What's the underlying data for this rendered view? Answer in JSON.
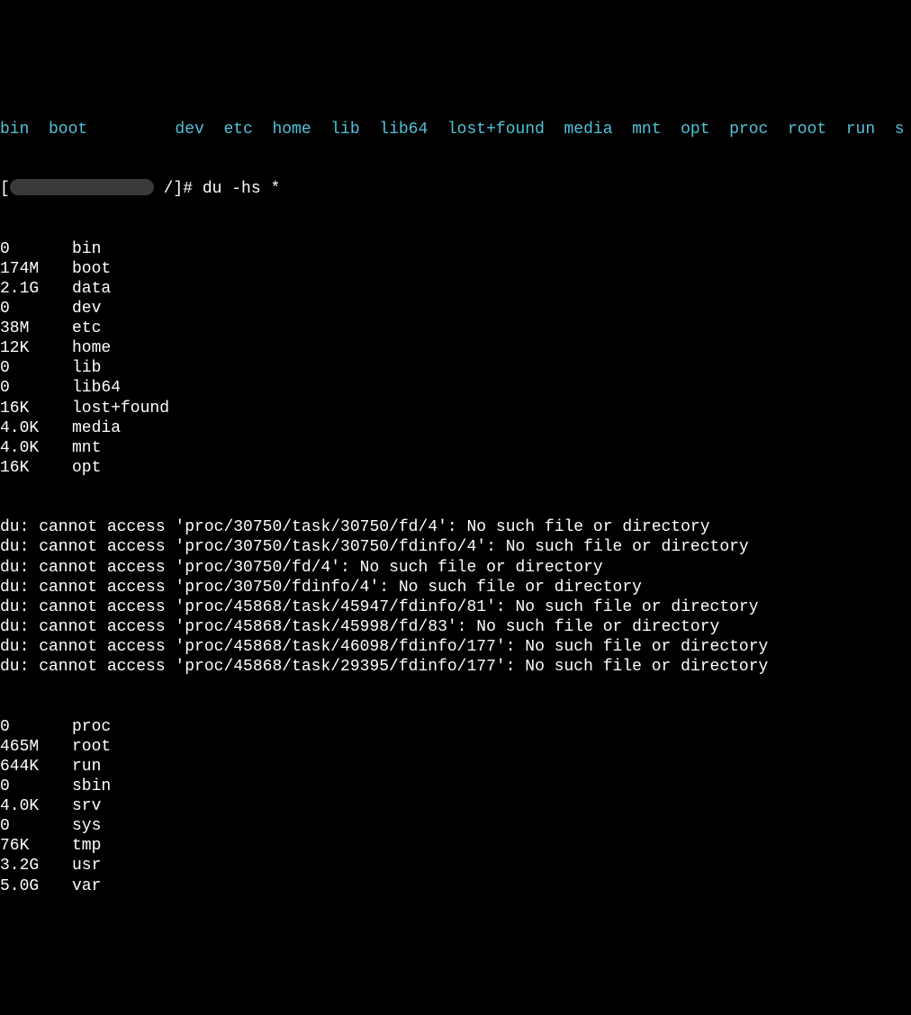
{
  "top_dirs": "bin  boot         dev  etc  home  lib  lib64  lost+found  media  mnt  opt  proc  root  run  s",
  "prompt": {
    "open_bracket": "[",
    "path_suffix": " /]# ",
    "command": "du -hs *"
  },
  "entries_before": [
    {
      "size": "0",
      "name": "bin"
    },
    {
      "size": "174M",
      "name": "boot"
    },
    {
      "size": "2.1G",
      "name": "data"
    },
    {
      "size": "0",
      "name": "dev"
    },
    {
      "size": "38M",
      "name": "etc"
    },
    {
      "size": "12K",
      "name": "home"
    },
    {
      "size": "0",
      "name": "lib"
    },
    {
      "size": "0",
      "name": "lib64"
    },
    {
      "size": "16K",
      "name": "lost+found"
    },
    {
      "size": "4.0K",
      "name": "media"
    },
    {
      "size": "4.0K",
      "name": "mnt"
    },
    {
      "size": "16K",
      "name": "opt"
    }
  ],
  "errors": [
    "du: cannot access 'proc/30750/task/30750/fd/4': No such file or directory",
    "du: cannot access 'proc/30750/task/30750/fdinfo/4': No such file or directory",
    "du: cannot access 'proc/30750/fd/4': No such file or directory",
    "du: cannot access 'proc/30750/fdinfo/4': No such file or directory",
    "du: cannot access 'proc/45868/task/45947/fdinfo/81': No such file or directory",
    "du: cannot access 'proc/45868/task/45998/fd/83': No such file or directory",
    "du: cannot access 'proc/45868/task/46098/fdinfo/177': No such file or directory",
    "du: cannot access 'proc/45868/task/29395/fdinfo/177': No such file or directory"
  ],
  "entries_after": [
    {
      "size": "0",
      "name": "proc"
    },
    {
      "size": "465M",
      "name": "root"
    },
    {
      "size": "644K",
      "name": "run"
    },
    {
      "size": "0",
      "name": "sbin"
    },
    {
      "size": "4.0K",
      "name": "srv"
    },
    {
      "size": "0",
      "name": "sys"
    },
    {
      "size": "76K",
      "name": "tmp"
    },
    {
      "size": "3.2G",
      "name": "usr"
    },
    {
      "size": "5.0G",
      "name": "var"
    }
  ]
}
